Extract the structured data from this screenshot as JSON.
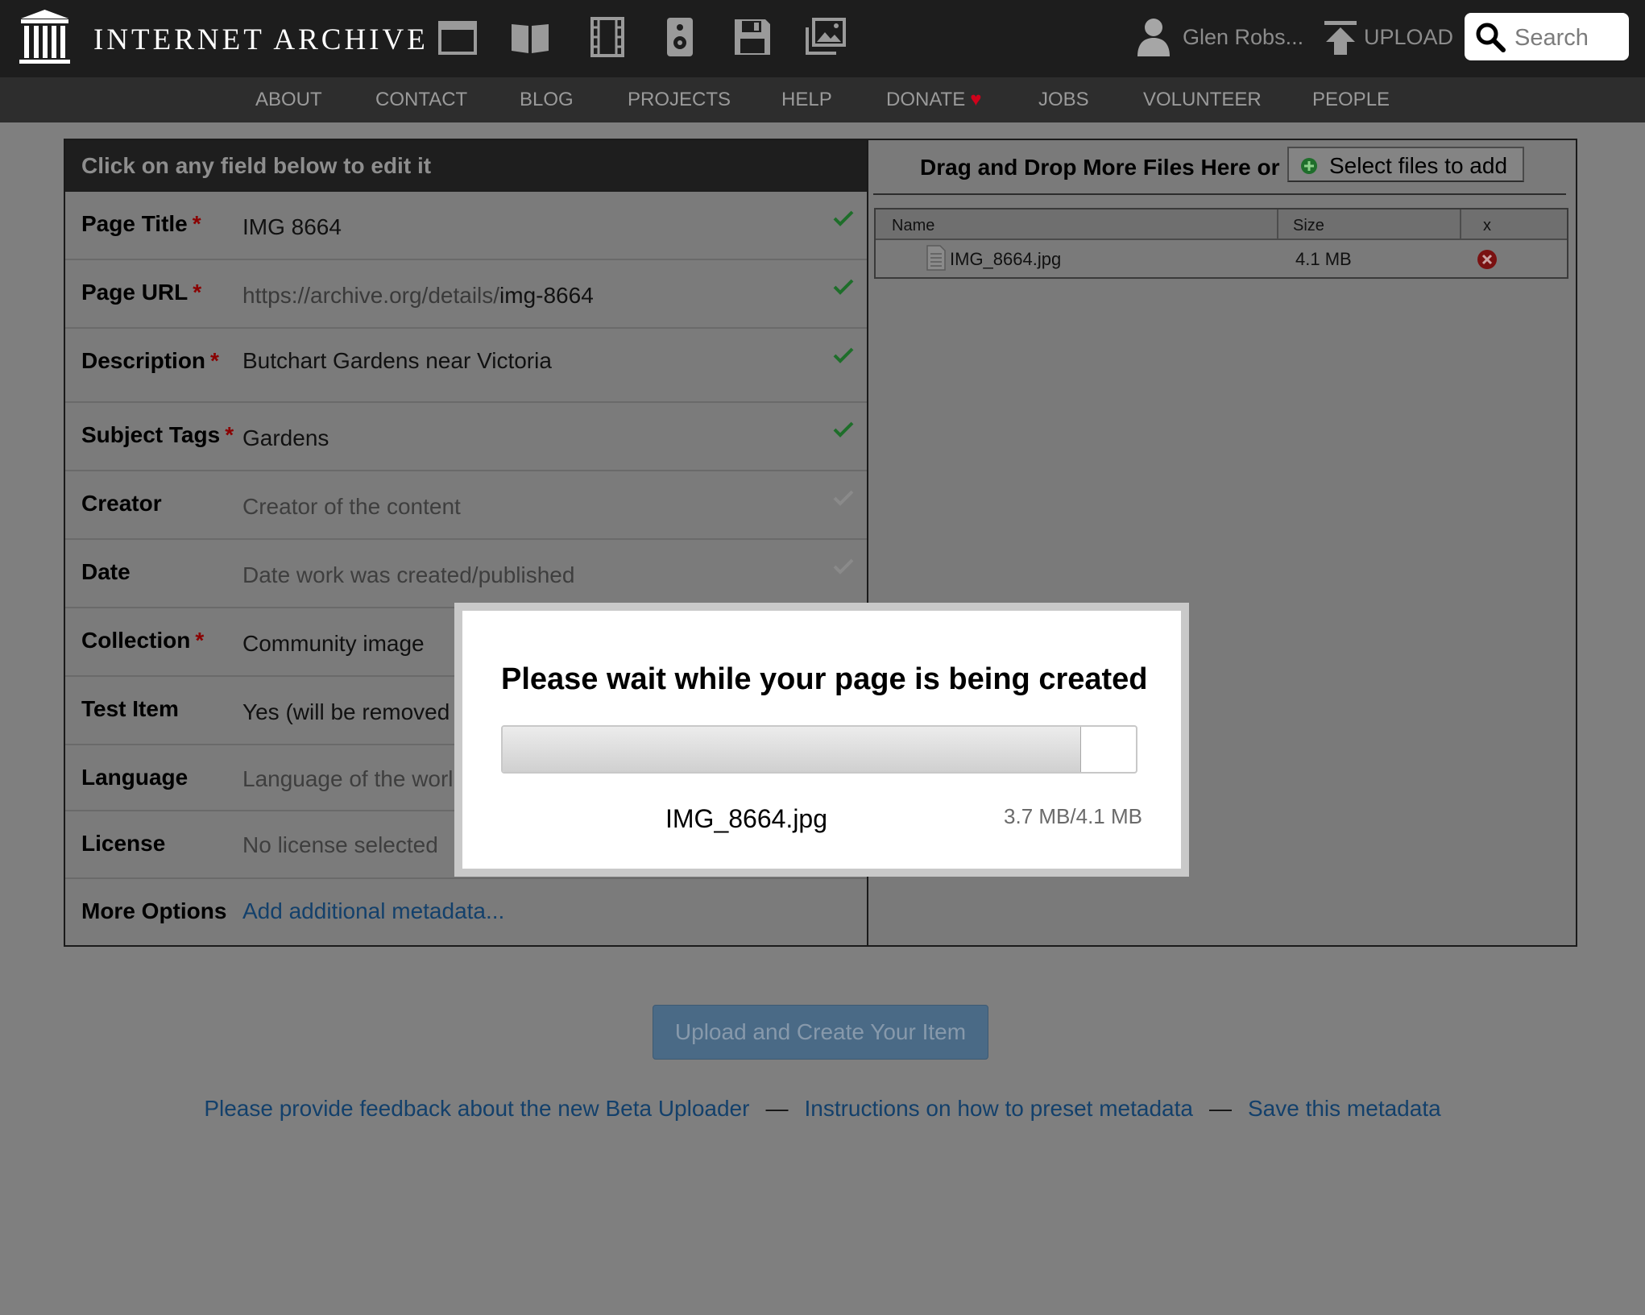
{
  "header": {
    "brand": "INTERNET ARCHIVE",
    "media_icons": [
      "web-icon",
      "texts-icon",
      "video-icon",
      "audio-icon",
      "software-icon",
      "images-icon"
    ],
    "user_name": "Glen Robs...",
    "upload_label": "UPLOAD",
    "search_placeholder": "Search"
  },
  "nav": {
    "items": [
      "ABOUT",
      "CONTACT",
      "BLOG",
      "PROJECTS",
      "HELP",
      "DONATE",
      "JOBS",
      "VOLUNTEER",
      "PEOPLE"
    ],
    "heart": "♥"
  },
  "form": {
    "heading": "Click on any field below to edit it",
    "required_mark": "*",
    "fields": {
      "title": {
        "label": "Page Title",
        "value": "IMG 8664"
      },
      "url": {
        "label": "Page URL",
        "prefix": "https://archive.org/details/",
        "value": "img-8664"
      },
      "description": {
        "label": "Description",
        "value": "Butchart Gardens near Victoria"
      },
      "subject": {
        "label": "Subject Tags",
        "value": "Gardens"
      },
      "creator": {
        "label": "Creator",
        "placeholder": "Creator of the content"
      },
      "date": {
        "label": "Date",
        "placeholder": "Date work was created/published"
      },
      "collection": {
        "label": "Collection",
        "value": "Community image"
      },
      "test_item": {
        "label": "Test Item",
        "value": "Yes (will be removed"
      },
      "language": {
        "label": "Language",
        "placeholder": "Language of the worl"
      },
      "license": {
        "label": "License",
        "placeholder": "No license selected"
      },
      "more_options": {
        "label": "More Options",
        "link": "Add additional metadata..."
      }
    }
  },
  "files": {
    "drop_text": "Drag and Drop More Files Here or",
    "select_button": "Select files to add",
    "columns": {
      "name": "Name",
      "size": "Size",
      "remove": "x"
    },
    "rows": [
      {
        "name": "IMG_8664.jpg",
        "size": "4.1 MB"
      }
    ]
  },
  "actions": {
    "upload_button": "Upload and Create Your Item"
  },
  "footer": {
    "feedback": "Please provide feedback about the new Beta Uploader",
    "instructions": "Instructions on how to preset metadata",
    "save": "Save this metadata",
    "separator": "—"
  },
  "modal": {
    "title": "Please wait while your page is being created",
    "progress_fraction": 0.912,
    "file_name": "IMG_8664.jpg",
    "size_text": "3.7 MB/4.1 MB"
  },
  "colors": {
    "topbar": "#1d1d1d",
    "navbar": "#2d2d2d",
    "overlay_gray": "#7f7f7f",
    "required_red": "#8a0000",
    "check_green": "#1e6e2a",
    "link_blue": "#13406b",
    "heart_red": "#d0021b",
    "upload_button": "#4a6a86"
  }
}
